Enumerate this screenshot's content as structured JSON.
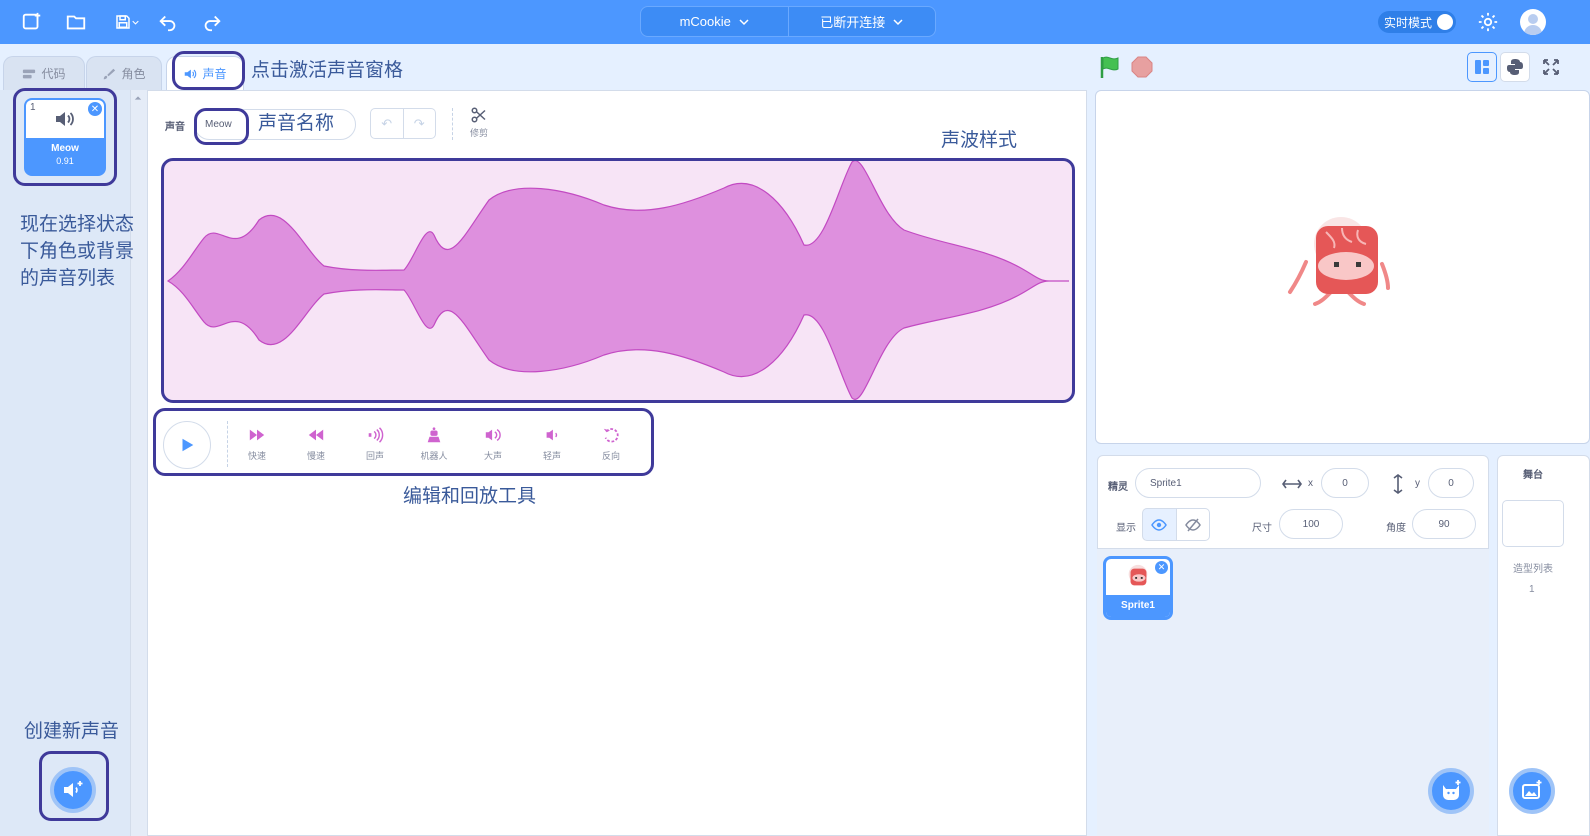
{
  "topbar": {
    "device": "mCookie",
    "connection": "已断开连接",
    "live_mode": "实时模式"
  },
  "tabs": [
    {
      "label": "代码",
      "icon": "code-icon"
    },
    {
      "label": "角色",
      "icon": "brush-icon"
    },
    {
      "label": "声音",
      "icon": "speaker-icon"
    }
  ],
  "sound_list": {
    "items": [
      {
        "index": "1",
        "name": "Meow",
        "duration": "0.91"
      }
    ]
  },
  "editor": {
    "sound_label": "声音",
    "sound_name": "Meow",
    "trim_label": "修剪",
    "effects": [
      "快速",
      "慢速",
      "回声",
      "机器人",
      "大声",
      "轻声",
      "反向"
    ]
  },
  "annotations": {
    "activate_tab": "点击激活声音窗格",
    "sound_name": "声音名称",
    "waveform": "声波样式",
    "sound_list": "现在选择状态下角色或背景的声音列表",
    "new_sound": "创建新声音",
    "tools": "编辑和回放工具"
  },
  "sprite_info": {
    "sprite_label": "精灵",
    "sprite_name": "Sprite1",
    "x_label": "x",
    "x": "0",
    "y_label": "y",
    "y": "0",
    "show_label": "显示",
    "size_label": "尺寸",
    "size": "100",
    "direction_label": "角度",
    "direction": "90"
  },
  "sprites": [
    {
      "name": "Sprite1"
    }
  ],
  "stage_panel": {
    "title": "舞台",
    "backdrops_label": "造型列表",
    "backdrop_count": "1"
  },
  "colors": {
    "accent": "#4c97ff",
    "highlight": "#3f3a9a",
    "wave_fill": "#de90de",
    "wave_stroke": "#c24ac2",
    "wave_bg": "#f7e4f6"
  }
}
